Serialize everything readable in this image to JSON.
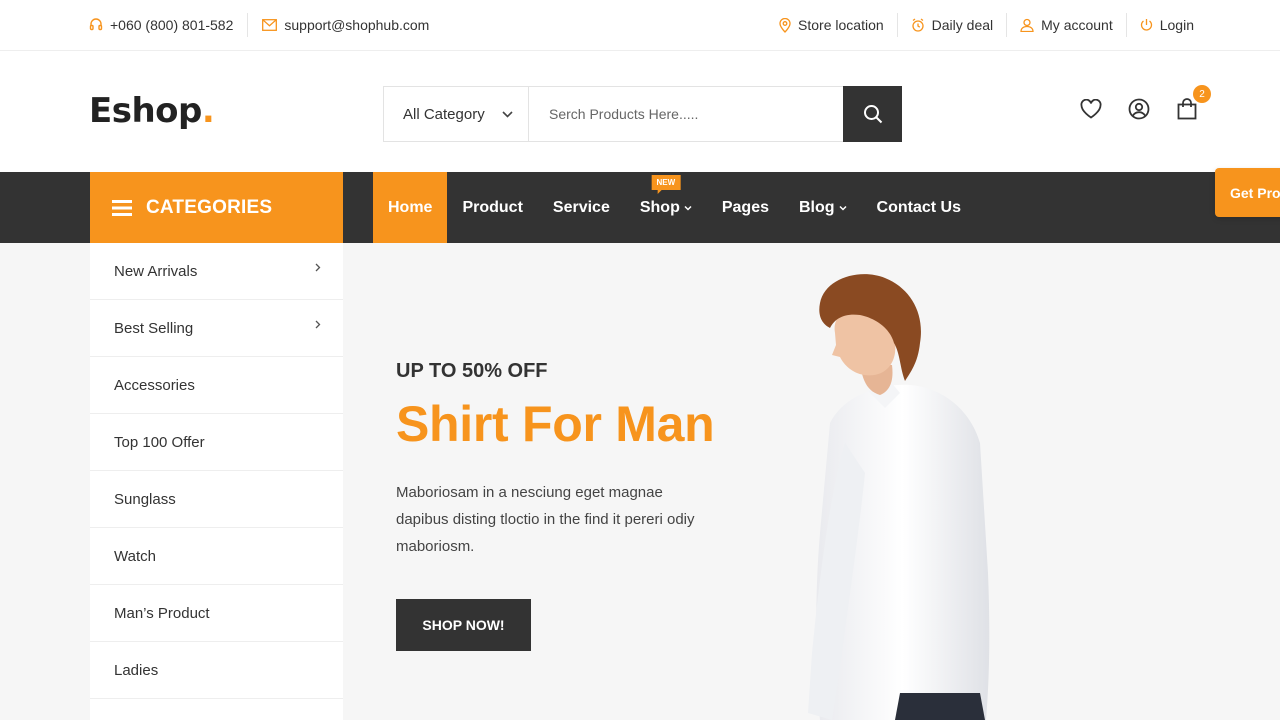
{
  "topbar": {
    "phone": "+060 (800) 801-582",
    "email": "support@shophub.com",
    "links": [
      "Store location",
      "Daily deal",
      "My account",
      "Login"
    ]
  },
  "header": {
    "logo_text": "Eshop",
    "logo_dot": ".",
    "search_category": "All Category",
    "search_placeholder": "Serch Products Here.....",
    "cart_count": "2"
  },
  "nav": {
    "categories_label": "CATEGORIES",
    "items": [
      "Home",
      "Product",
      "Service",
      "Shop",
      "Pages",
      "Blog",
      "Contact Us"
    ],
    "new_tag": "NEW",
    "get_pro": "Get Pro"
  },
  "sidebar": {
    "items": [
      "New Arrivals",
      "Best Selling",
      "Accessories",
      "Top 100 Offer",
      "Sunglass",
      "Watch",
      "Man’s Product",
      "Ladies"
    ]
  },
  "hero": {
    "subtitle": "UP TO 50% OFF",
    "title": "Shirt For Man",
    "description": "Maboriosam in a nesciung eget magnae dapibus disting tloctio in the find it pereri odiy maboriosm.",
    "button": "SHOP NOW!"
  },
  "colors": {
    "accent": "#f7941d",
    "dark": "#333333"
  }
}
